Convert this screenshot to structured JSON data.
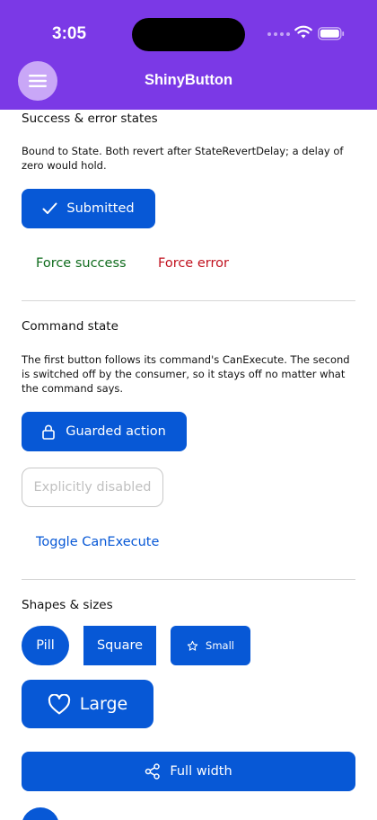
{
  "status_bar": {
    "time": "3:05"
  },
  "header": {
    "title": "ShinyButton",
    "menu_icon": "hamburger-icon"
  },
  "colors": {
    "header": "#7b39e6",
    "primary": "#0758d6",
    "success_text": "#0e6b1c",
    "error_text": "#c1121f",
    "link": "#0758d6"
  },
  "sections": {
    "success_error": {
      "title": "Success & error states",
      "description": "Bound to State. Both revert after StateRevertDelay; a delay of zero would hold.",
      "submitted_button": "Submitted",
      "force_success": "Force success",
      "force_error": "Force error"
    },
    "command_state": {
      "title": "Command state",
      "description": "The first button follows its command's CanExecute. The second is switched off by the consumer, so it stays off no matter what the command says.",
      "guarded_button": "Guarded action",
      "disabled_button": "Explicitly disabled",
      "toggle_link": "Toggle CanExecute"
    },
    "shapes_sizes": {
      "title": "Shapes & sizes",
      "pill": "Pill",
      "square": "Square",
      "small": "Small",
      "large": "Large",
      "full_width": "Full width"
    }
  }
}
